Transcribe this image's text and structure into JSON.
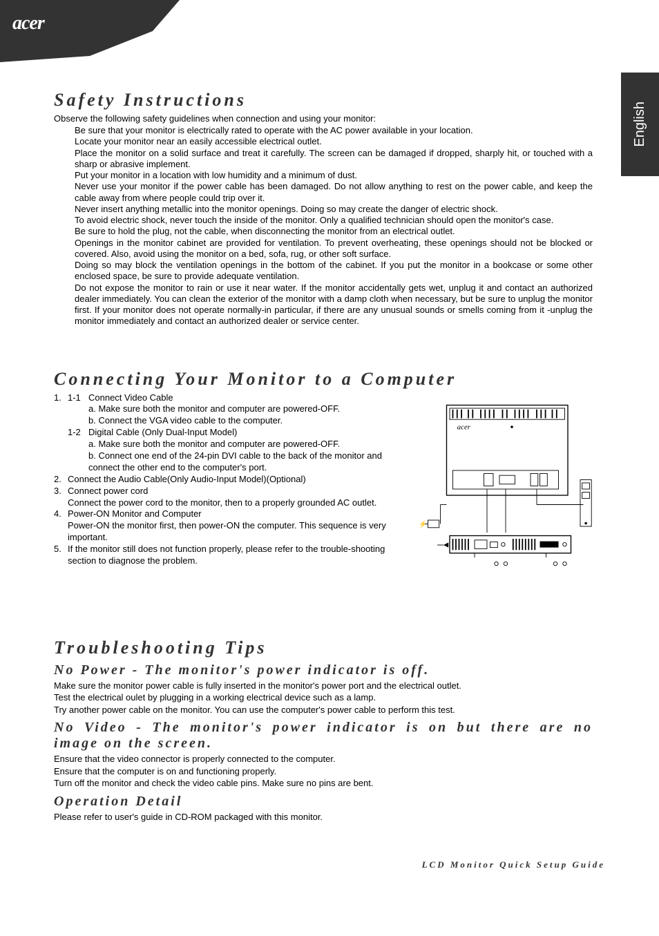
{
  "brand": "acer",
  "language_tab": "English",
  "section1": {
    "heading": "Safety Instructions",
    "intro": "Observe the following safety guidelines when connection and using your monitor:",
    "bullets": [
      "Be sure that your monitor is electrically rated to operate with the AC power available in your location.",
      "Locate your monitor near an easily accessible electrical outlet.",
      "Place the monitor on a solid surface and treat it carefully. The screen can be damaged if dropped, sharply hit, or touched with a sharp or abrasive implement.",
      "Put your monitor in a location with low humidity and a minimum of dust.",
      "Never use your monitor if the power cable has been damaged. Do not allow anything to rest on the power cable, and keep the cable away from where people could trip over it.",
      "Never insert anything metallic into the monitor openings. Doing so may create the danger of electric shock.",
      "To avoid electric shock, never touch the inside of the monitor. Only a qualified technician should open the monitor's case.",
      "Be sure to hold the plug, not the cable, when disconnecting the monitor from an electrical outlet.",
      "Openings in the monitor cabinet are provided for ventilation. To prevent overheating, these openings should not be blocked or covered. Also, avoid using the monitor on a bed, sofa, rug, or other soft surface.",
      "Doing so may block the ventilation openings in the bottom of the cabinet. If you put the monitor in a bookcase or some other enclosed space, be sure to provide adequate ventilation.",
      "Do not expose the monitor to rain or use it near water. If the monitor accidentally gets wet, unplug it and contact an authorized dealer immediately. You can clean the exterior of the monitor with a damp cloth when necessary, but be sure to unplug the monitor first. If your monitor does not operate normally-in particular, if there are any unusual sounds or smells coming from it -unplug the monitor immediately and contact an authorized dealer or service center."
    ]
  },
  "section2": {
    "heading": "Connecting Your Monitor to a Computer",
    "items": {
      "n1": "1.",
      "n1_1": "1-1",
      "n1_1_title": "Connect Video Cable",
      "n1_1_a": "a. Make sure both the monitor and computer are powered-OFF.",
      "n1_1_b": "b. Connect the VGA video cable to the computer.",
      "n1_2": "1-2",
      "n1_2_title": "Digital Cable (Only Dual-Input Model)",
      "n1_2_a": "a. Make sure both the monitor and computer are powered-OFF.",
      "n1_2_b": "b. Connect one end of the 24-pin DVI cable to the back of the monitor and connect the other end to the computer's port.",
      "n2": "2.",
      "n2_text": "Connect the Audio Cable(Only Audio-Input Model)(Optional)",
      "n3": "3.",
      "n3_title": "Connect power cord",
      "n3_text": "Connect the power cord to the monitor, then to a properly grounded AC outlet.",
      "n4": "4.",
      "n4_title": "Power-ON Monitor and Computer",
      "n4_text": "Power-ON the monitor first, then power-ON the computer. This sequence is very important.",
      "n5": "5.",
      "n5_text": "If the monitor still does not function properly, please refer to the trouble-shooting section to diagnose the problem."
    },
    "diagram_label": "acer"
  },
  "section3": {
    "heading": "Troubleshooting Tips",
    "sub1": "No Power - The monitor's power indicator is off.",
    "sub1_lines": [
      "Make sure the monitor power cable is fully inserted in the monitor's power port and the electrical outlet.",
      "Test the electrical oulet by plugging in a working electrical device such as a lamp.",
      "Try another power cable on the monitor. You can use the computer's power cable to perform this test."
    ],
    "sub2": "No Video - The monitor's power indicator is on but there are no image on the screen.",
    "sub2_lines": [
      "Ensure that the video connector is properly connected to the computer.",
      "Ensure that the computer is on and functioning properly.",
      "Turn off the monitor and check the video cable pins. Make sure no pins are bent."
    ],
    "sub3": "Operation Detail",
    "sub3_line": "Please refer to user's guide in CD-ROM packaged with this monitor."
  },
  "footer": "LCD Monitor Quick Setup Guide"
}
